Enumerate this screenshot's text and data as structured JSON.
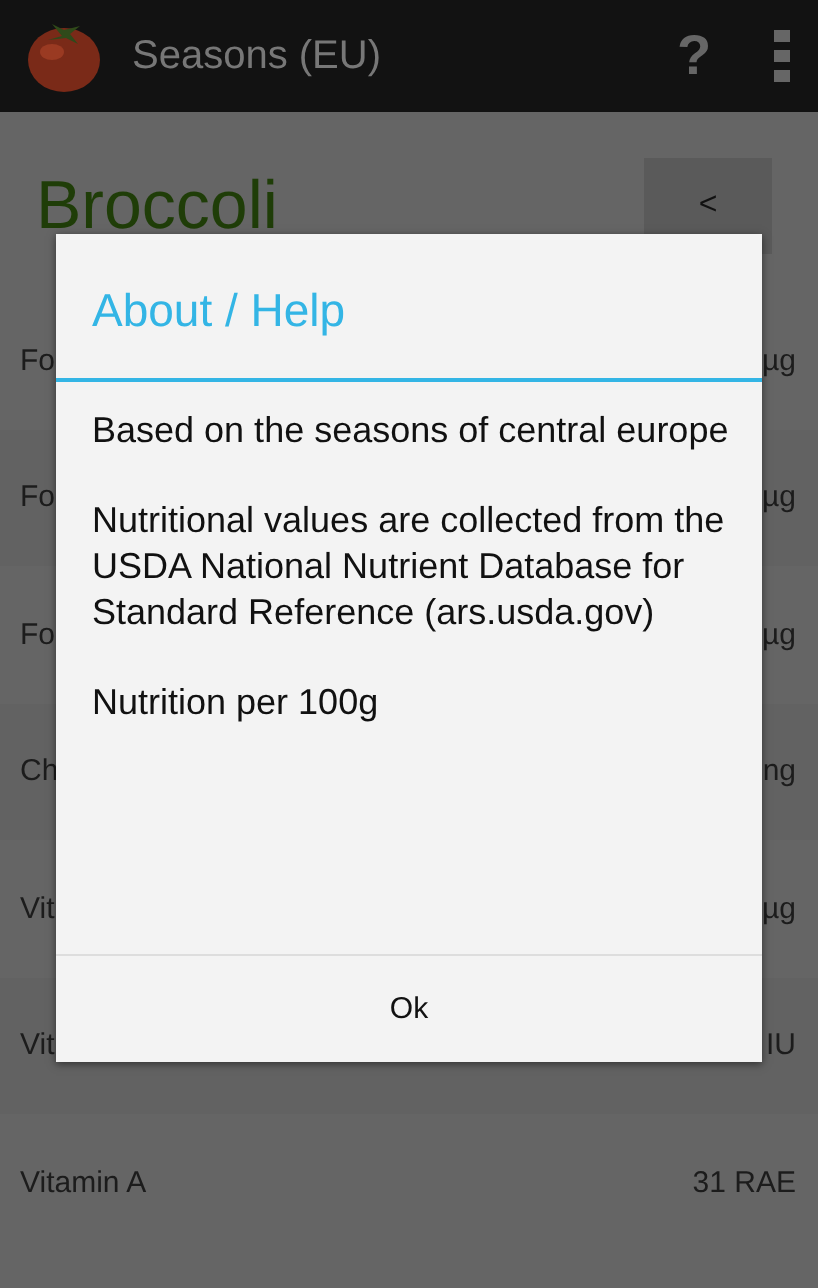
{
  "app_bar": {
    "title": "Seasons (EU)",
    "help": "?"
  },
  "heading": {
    "title": "Broccoli",
    "back_button": "<"
  },
  "rows": [
    {
      "label": "Fo",
      "value": "µg"
    },
    {
      "label": "Fo",
      "value": "µg"
    },
    {
      "label": "Fo",
      "value": "µg"
    },
    {
      "label": "Ch",
      "value": "ng"
    },
    {
      "label": "Vit",
      "value": "µg"
    },
    {
      "label": "Vit",
      "value": "IU"
    },
    {
      "label": "Vitamin A",
      "value": "31 RAE"
    }
  ],
  "dialog": {
    "title": "About / Help",
    "paragraphs": [
      "Based on the seasons of central europe",
      "Nutritional values are collected from the USDA National Nutrient Database for Standard Reference (ars.usda.gov)",
      "Nutrition per 100g"
    ],
    "button": "Ok"
  }
}
